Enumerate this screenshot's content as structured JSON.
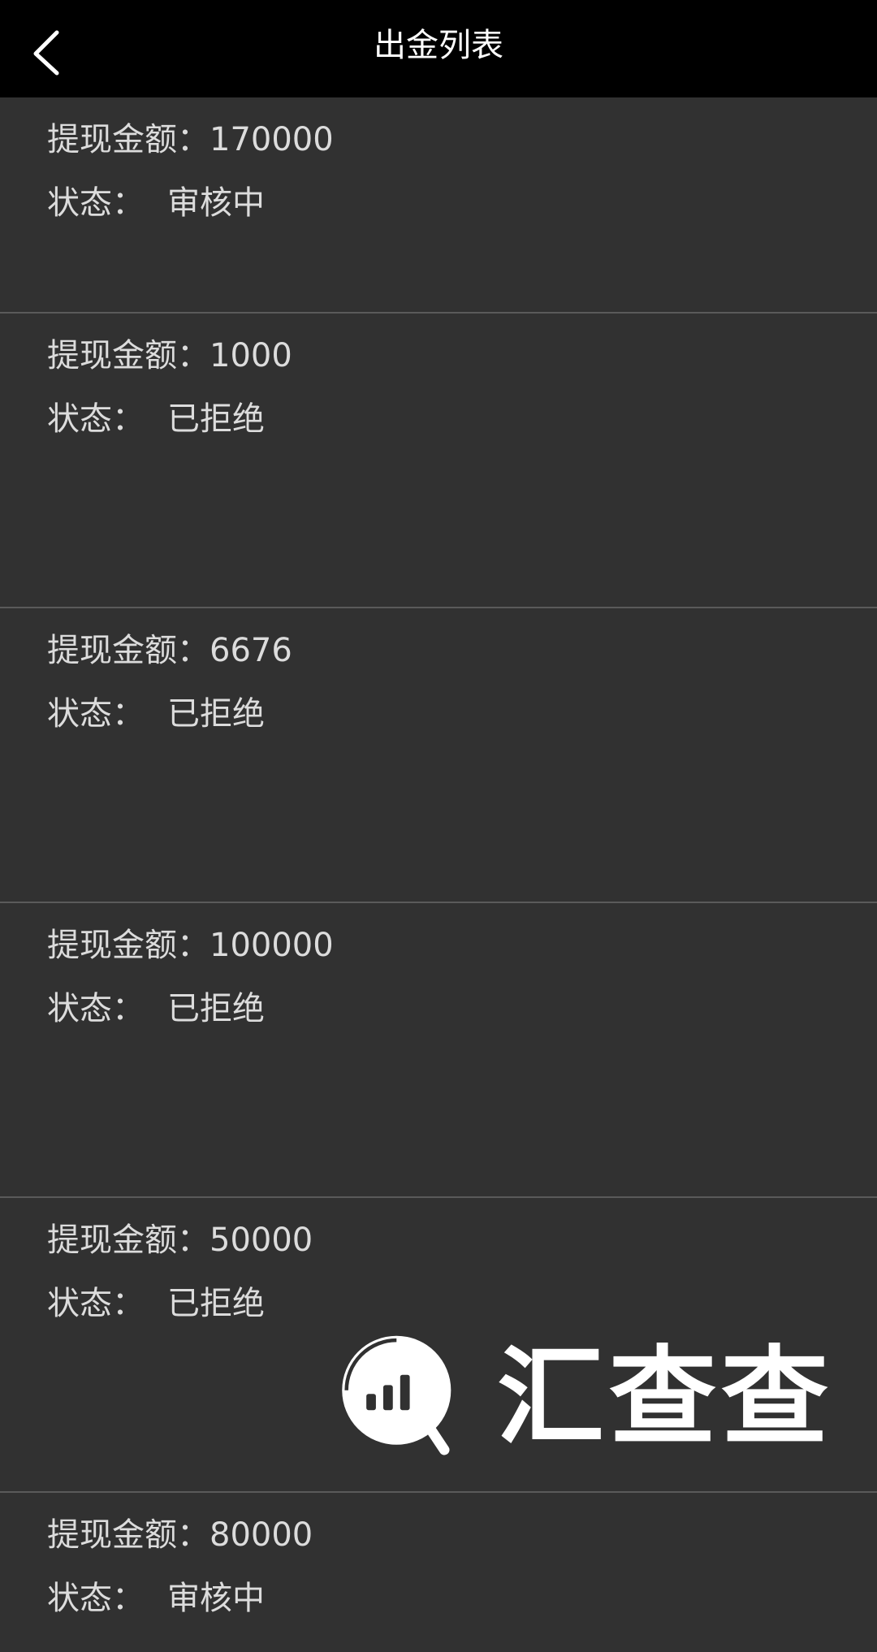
{
  "header": {
    "title": "出金列表",
    "back_icon": "chevron-left-icon"
  },
  "records": [
    {
      "amount_label": "提现金额：",
      "amount": "170000",
      "status_label": "状态：",
      "status": "审核中"
    },
    {
      "amount_label": "提现金额：",
      "amount": "1000",
      "status_label": "状态：",
      "status": "已拒绝"
    },
    {
      "amount_label": "提现金额：",
      "amount": "6676",
      "status_label": "状态：",
      "status": "已拒绝"
    },
    {
      "amount_label": "提现金额：",
      "amount": "100000",
      "status_label": "状态：",
      "status": "已拒绝"
    },
    {
      "amount_label": "提现金额：",
      "amount": "50000",
      "status_label": "状态：",
      "status": "已拒绝"
    },
    {
      "amount_label": "提现金额：",
      "amount": "80000",
      "status_label": "状态：",
      "status": "审核中"
    }
  ],
  "watermark": {
    "text": "汇查查",
    "icon": "bar-chart-magnifier-icon"
  },
  "colors": {
    "header_bg": "#000000",
    "page_bg": "#313131",
    "text": "#dcdcdc",
    "divider": "#5a5a5a"
  }
}
